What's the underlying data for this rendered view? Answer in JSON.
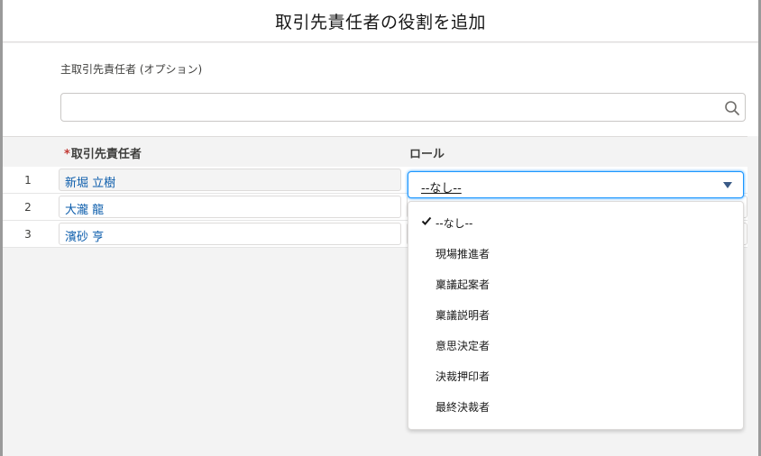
{
  "modal": {
    "title": "取引先責任者の役割を追加",
    "primary_label": "主取引先責任者 (オプション)",
    "search_value": ""
  },
  "table": {
    "col_contact": "取引先責任者",
    "col_role": "ロール",
    "rows": [
      {
        "num": "1",
        "contact": "新堀 立樹"
      },
      {
        "num": "2",
        "contact": "大瀧 龍"
      },
      {
        "num": "3",
        "contact": "濱砂 亨"
      }
    ]
  },
  "role_select": {
    "value": "--なし--",
    "options": [
      "--なし--",
      "現場推進者",
      "稟議起案者",
      "稟議説明者",
      "意思決定者",
      "決裁押印者",
      "最終決裁者"
    ],
    "selected_index": 0
  },
  "icons": {
    "search": "search-icon",
    "check": "check-icon",
    "caret": "caret-down-icon"
  },
  "colors": {
    "link": "#0b5cab",
    "focus": "#1b96ff",
    "required": "#c23934"
  }
}
